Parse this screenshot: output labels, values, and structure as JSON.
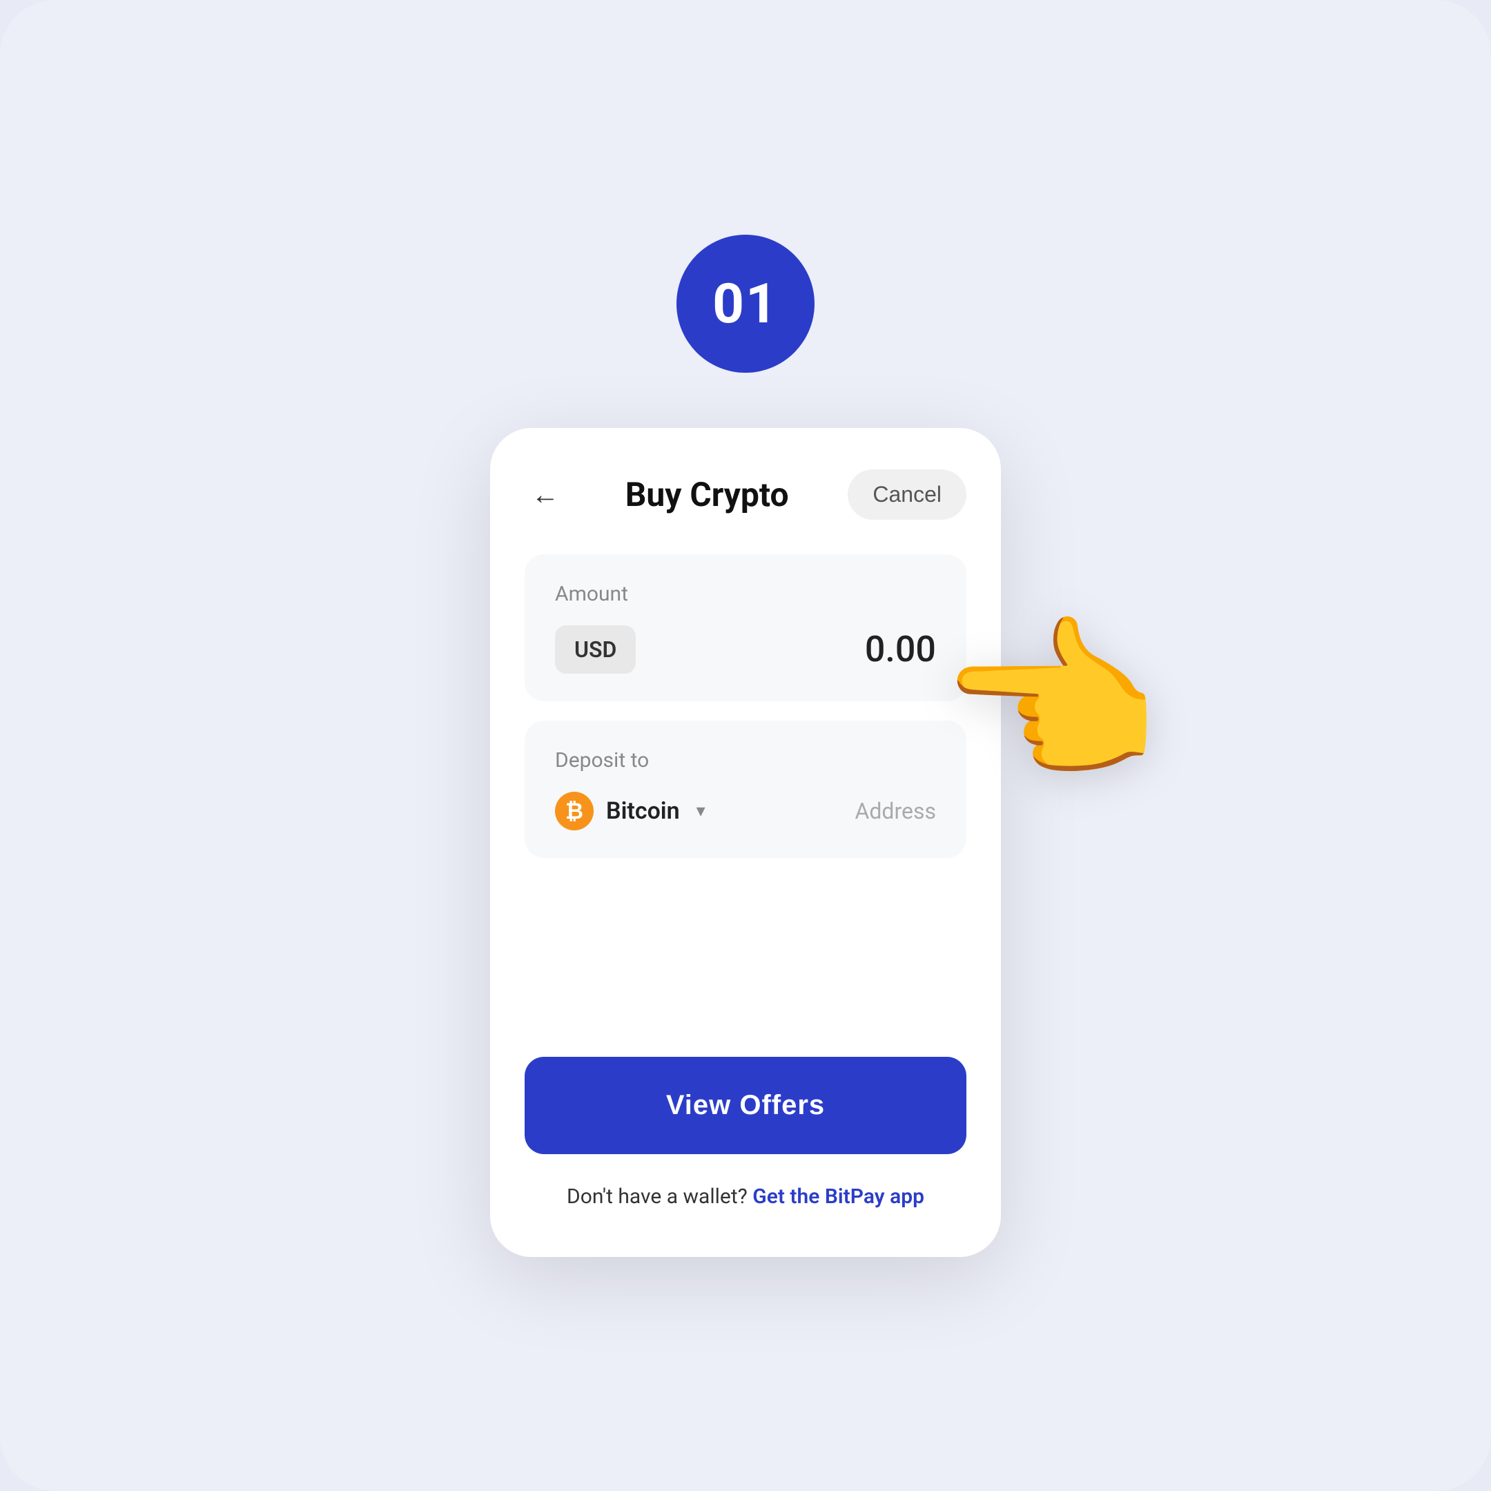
{
  "page": {
    "background_color": "#eceef8"
  },
  "step_badge": {
    "number": "01"
  },
  "header": {
    "title": "Buy Crypto",
    "cancel_label": "Cancel",
    "back_label": "←"
  },
  "amount_section": {
    "label": "Amount",
    "currency": "USD",
    "value": "0.00"
  },
  "deposit_section": {
    "label": "Deposit to",
    "crypto_name": "Bitcoin",
    "address_placeholder": "Address"
  },
  "cta": {
    "view_offers_label": "View Offers"
  },
  "footer": {
    "no_wallet_text": "Don't have a wallet?",
    "link_text": "Get the BitPay app"
  }
}
